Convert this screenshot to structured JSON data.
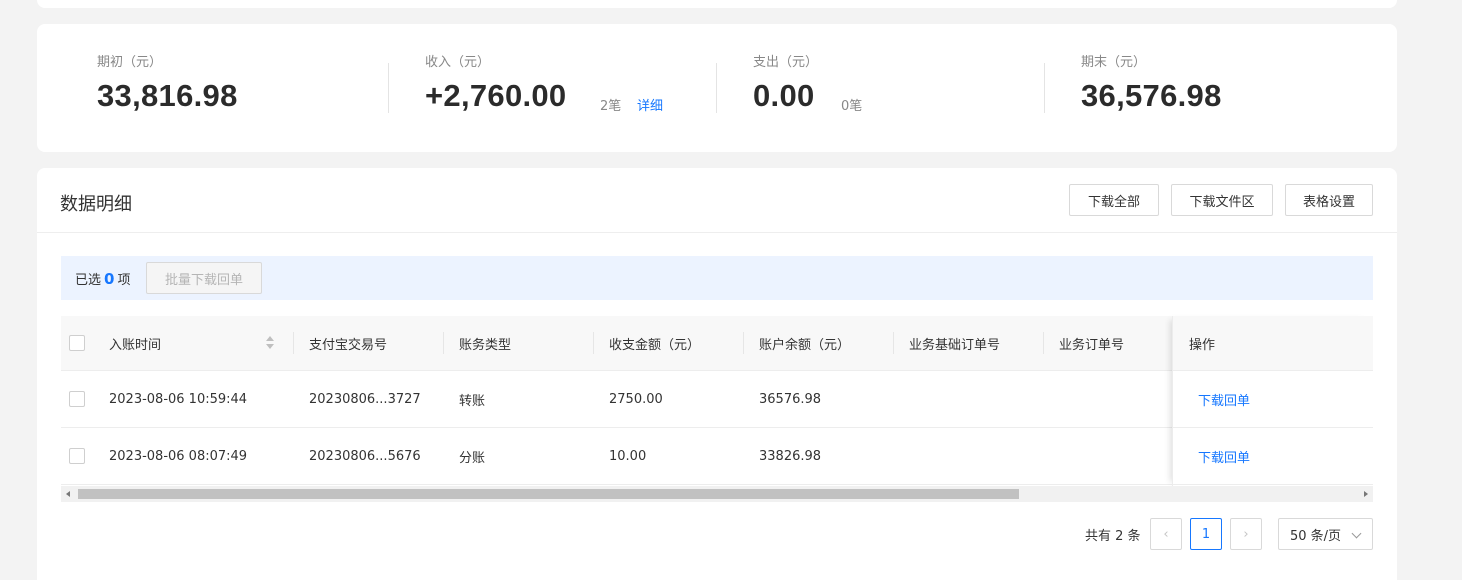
{
  "summary": {
    "opening": {
      "label": "期初（元）",
      "value": "33,816.98"
    },
    "income": {
      "label": "收入（元）",
      "value": "+2,760.00",
      "count": "2笔",
      "detail_link": "详细"
    },
    "expense": {
      "label": "支出（元）",
      "value": "0.00",
      "count": "0笔"
    },
    "closing": {
      "label": "期末（元）",
      "value": "36,576.98"
    }
  },
  "panel": {
    "title": "数据明细",
    "buttons": {
      "download_all": "下载全部",
      "download_area": "下载文件区",
      "table_settings": "表格设置"
    }
  },
  "selection": {
    "prefix": "已选",
    "count": "0",
    "suffix": "项",
    "batch_button": "批量下载回单"
  },
  "table": {
    "columns": [
      "入账时间",
      "支付宝交易号",
      "账务类型",
      "收支金额（元）",
      "账户余额（元）",
      "业务基础订单号",
      "业务订单号",
      "操作"
    ],
    "rows": [
      {
        "time": "2023-08-06 10:59:44",
        "trade_no": "20230806...3727",
        "type": "转账",
        "amount": "2750.00",
        "balance": "36576.98",
        "base_order": "",
        "order": "",
        "action": "下载回单"
      },
      {
        "time": "2023-08-06 08:07:49",
        "trade_no": "20230806...5676",
        "type": "分账",
        "amount": "10.00",
        "balance": "33826.98",
        "base_order": "",
        "order": "",
        "action": "下载回单"
      }
    ]
  },
  "pagination": {
    "total": "共有 2 条",
    "current_page": "1",
    "page_size": "50 条/页"
  }
}
